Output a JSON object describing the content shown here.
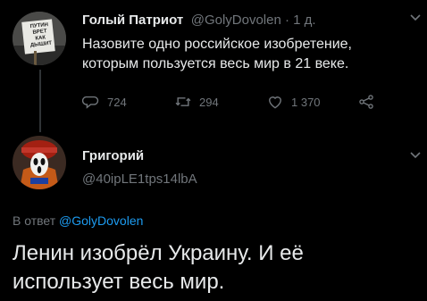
{
  "tweet1": {
    "name": "Голый Патриот",
    "handle": "@GolyDovolen",
    "separator": " · ",
    "time": "1 д.",
    "text_line1": "Назовите одно российское изобретение,",
    "text_line2": "которым пользуется весь мир в 21 веке.",
    "avatar_sign_text": "ПУТИН\nВРЕТ\nКАК\nДЫШИТ",
    "replies": "724",
    "retweets": "294",
    "likes": "1 370",
    "icons": {
      "reply": "comment-icon",
      "retweet": "retweet-icon",
      "like": "heart-icon",
      "share": "share-icon",
      "more": "chevron-down-icon"
    }
  },
  "tweet2": {
    "name": "Григорий",
    "handle": "@40ipLE1tps14lbA",
    "reply_prefix": "В ответ ",
    "reply_handle": "@GolyDovolen",
    "text_line1": "Ленин изобрёл Украину. И её",
    "text_line2": "использует весь мир."
  },
  "colors": {
    "background": "#000000",
    "text": "#e7e9ea",
    "secondary": "#71767b",
    "link": "#1d9bf0"
  }
}
